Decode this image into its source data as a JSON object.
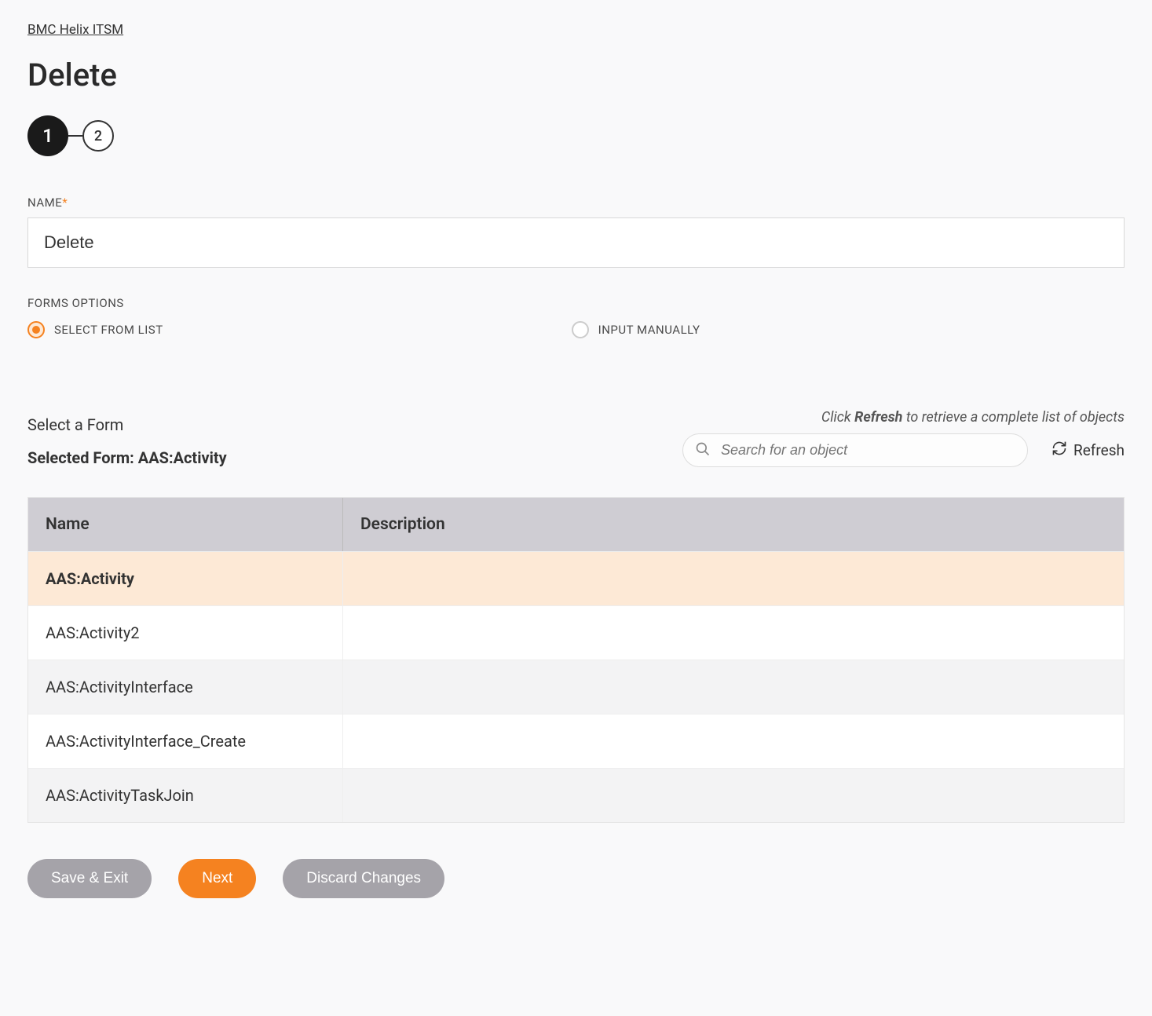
{
  "breadcrumb": "BMC Helix ITSM",
  "page_title": "Delete",
  "stepper": {
    "steps": [
      "1",
      "2"
    ],
    "active": 0
  },
  "name_field": {
    "label": "NAME",
    "value": "Delete"
  },
  "forms_options": {
    "label": "FORMS OPTIONS",
    "options": [
      {
        "label": "SELECT FROM LIST",
        "selected": true
      },
      {
        "label": "INPUT MANUALLY",
        "selected": false
      }
    ]
  },
  "form_select": {
    "title": "Select a Form",
    "selected_prefix": "Selected Form: ",
    "selected_value": "AAS:Activity",
    "hint_prefix": "Click ",
    "hint_bold": "Refresh",
    "hint_suffix": " to retrieve a complete list of objects",
    "search_placeholder": "Search for an object",
    "refresh_label": "Refresh"
  },
  "table": {
    "headers": {
      "name": "Name",
      "description": "Description"
    },
    "rows": [
      {
        "name": "AAS:Activity",
        "description": "",
        "selected": true
      },
      {
        "name": "AAS:Activity2",
        "description": "",
        "selected": false
      },
      {
        "name": "AAS:ActivityInterface",
        "description": "",
        "selected": false
      },
      {
        "name": "AAS:ActivityInterface_Create",
        "description": "",
        "selected": false
      },
      {
        "name": "AAS:ActivityTaskJoin",
        "description": "",
        "selected": false
      }
    ]
  },
  "buttons": {
    "save_exit": "Save & Exit",
    "next": "Next",
    "discard": "Discard Changes"
  }
}
